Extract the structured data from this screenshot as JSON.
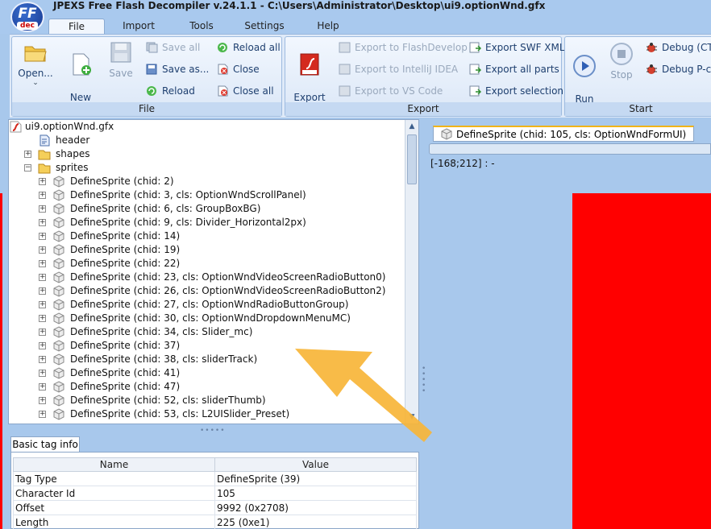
{
  "window": {
    "logo_text": "FF",
    "logo_sub": "dec",
    "title": "JPEXS Free Flash Decompiler v.24.1.1 - C:\\Users\\Administrator\\Desktop\\ui9.optionWnd.gfx"
  },
  "tabs": [
    {
      "label": "File",
      "active": true
    },
    {
      "label": "Import",
      "active": false
    },
    {
      "label": "Tools",
      "active": false
    },
    {
      "label": "Settings",
      "active": false
    },
    {
      "label": "Help",
      "active": false
    }
  ],
  "ribbon": {
    "file_group": {
      "caption": "File",
      "open_label": "Open...",
      "new_empty_label": "New\nempty",
      "save_label": "Save",
      "save_all_label": "Save all",
      "save_as_label": "Save as...",
      "reload_label": "Reload",
      "reload_all_label": "Reload all",
      "close_label": "Close",
      "close_all_label": "Close all"
    },
    "export_group": {
      "caption": "Export",
      "export_fla_label": "Export\nto FLA",
      "export_flashdevelop_label": "Export to FlashDevelop",
      "export_intellij_label": "Export to IntelliJ IDEA",
      "export_vscode_label": "Export to VS Code",
      "export_swf_xml_label": "Export SWF XML",
      "export_all_parts_label": "Export all parts",
      "export_selection_label": "Export selection"
    },
    "start_group": {
      "caption": "Start",
      "run_label": "Run\n(F6)",
      "stop_label": "Stop",
      "debug_ct_label": "Debug (CT",
      "debug_pc_label": "Debug P-c"
    }
  },
  "tree": {
    "root": "ui9.optionWnd.gfx",
    "header": "header",
    "shapes": "shapes",
    "sprites": "sprites",
    "sprite_items": [
      "DefineSprite (chid: 2)",
      "DefineSprite (chid: 3, cls: OptionWndScrollPanel)",
      "DefineSprite (chid: 6, cls: GroupBoxBG)",
      "DefineSprite (chid: 9, cls: Divider_Horizontal2px)",
      "DefineSprite (chid: 14)",
      "DefineSprite (chid: 19)",
      "DefineSprite (chid: 22)",
      "DefineSprite (chid: 23, cls: OptionWndVideoScreenRadioButton0)",
      "DefineSprite (chid: 26, cls: OptionWndVideoScreenRadioButton2)",
      "DefineSprite (chid: 27, cls: OptionWndRadioButtonGroup)",
      "DefineSprite (chid: 30, cls: OptionWndDropdownMenuMC)",
      "DefineSprite (chid: 34, cls: Slider_mc)",
      "DefineSprite (chid: 37)",
      "DefineSprite (chid: 38, cls: sliderTrack)",
      "DefineSprite (chid: 41)",
      "DefineSprite (chid: 47)",
      "DefineSprite (chid: 52, cls: sliderThumb)",
      "DefineSprite (chid: 53, cls: L2UISlider_Preset)"
    ]
  },
  "tag_info": {
    "tab_label": "Basic tag info",
    "col_name": "Name",
    "col_value": "Value",
    "rows": [
      {
        "name": "Tag Type",
        "value": "DefineSprite (39)"
      },
      {
        "name": "Character Id",
        "value": "105"
      },
      {
        "name": "Offset",
        "value": "9992 (0x2708)"
      },
      {
        "name": "Length",
        "value": "225 (0xe1)"
      }
    ]
  },
  "preview": {
    "tab_label": "DefineSprite (chid: 105, cls: OptionWndFormUI)",
    "coord_text": "[-168;212] :  -"
  },
  "colors": {
    "accent": "#f0b418",
    "canvas_red": "#ff0000",
    "arrow": "#f7b538"
  }
}
